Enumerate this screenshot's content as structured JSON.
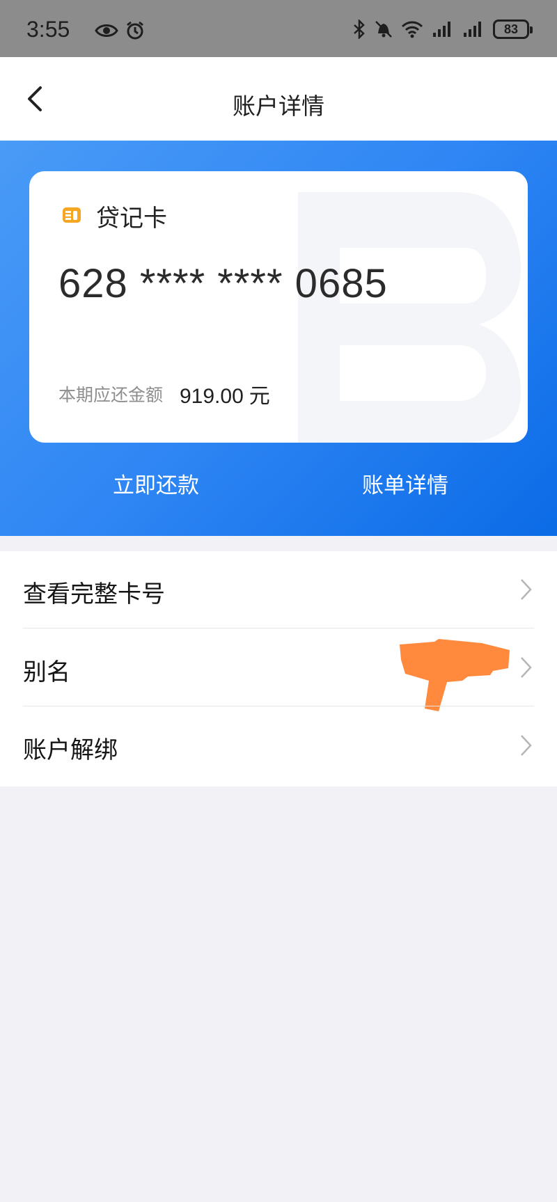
{
  "status_bar": {
    "time": "3:55",
    "battery": "83",
    "icons": [
      "eye-icon",
      "alarm-icon",
      "bluetooth-icon",
      "mute-icon",
      "wifi-icon",
      "signal-icon",
      "signal-icon"
    ]
  },
  "header": {
    "title": "账户详情",
    "back_icon": "chevron-left-icon"
  },
  "card": {
    "type": "贷记卡",
    "number": "628 **** **** 0685",
    "amount_label": "本期应还金额",
    "amount_value": "919.00",
    "amount_unit": "元",
    "icon": "card-logo-icon",
    "brand_color": "#f5a623"
  },
  "actions": {
    "repay": "立即还款",
    "bill": "账单详情"
  },
  "menu": {
    "items": [
      {
        "label": "查看完整卡号"
      },
      {
        "label": "别名"
      },
      {
        "label": "账户解绑"
      }
    ]
  },
  "colors": {
    "hero_start": "#4a9bf6",
    "hero_end": "#0b6be6",
    "page_bg": "#f2f1f6",
    "redaction": "#ff8a3d"
  }
}
